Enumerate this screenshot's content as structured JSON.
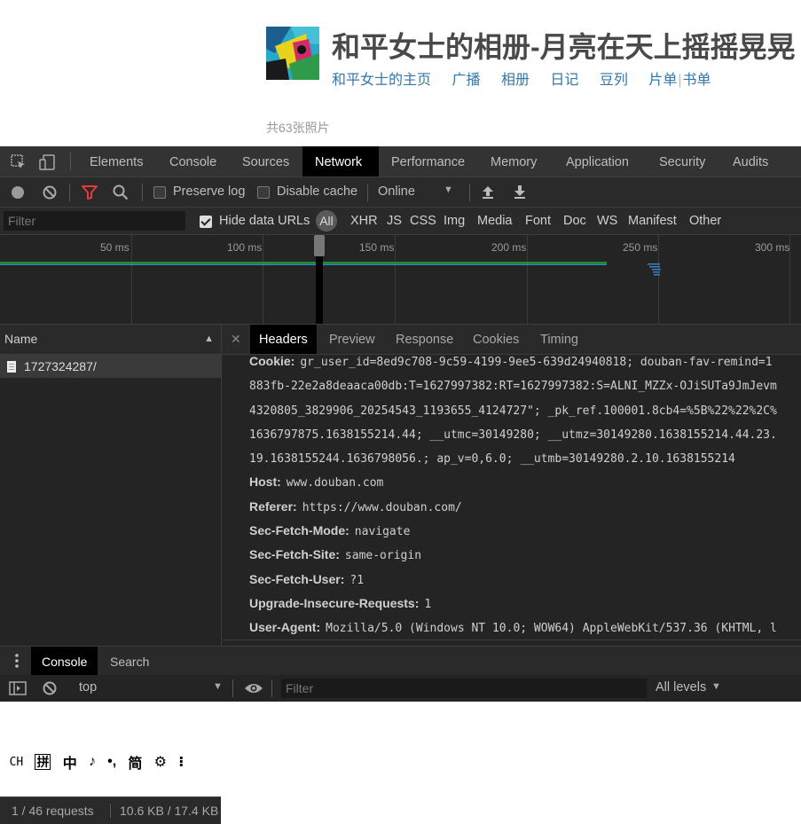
{
  "page": {
    "title": "和平女士的相册-月亮在天上摇摇晃晃",
    "nav": [
      "和平女士的主页",
      "广播",
      "相册",
      "日记",
      "豆列"
    ],
    "nav_extra": [
      "片单",
      "书单"
    ],
    "photo_count": "共63张照片"
  },
  "devtools": {
    "main_tabs": [
      "Elements",
      "Console",
      "Sources",
      "Network",
      "Performance",
      "Memory",
      "Application",
      "Security",
      "Audits"
    ],
    "active_tab": "Network",
    "toolbar": {
      "preserve_log": "Preserve log",
      "disable_cache": "Disable cache",
      "throttle": "Online"
    },
    "filterbar": {
      "filter_placeholder": "Filter",
      "hide_data_urls": "Hide data URLs",
      "types": [
        "All",
        "XHR",
        "JS",
        "CSS",
        "Img",
        "Media",
        "Font",
        "Doc",
        "WS",
        "Manifest",
        "Other"
      ]
    },
    "timeline_ticks": [
      "50 ms",
      "100 ms",
      "150 ms",
      "200 ms",
      "250 ms",
      "300 ms"
    ],
    "name_pane": {
      "header": "Name",
      "row": "1727324287/",
      "summary_requests": "1 / 46 requests",
      "summary_size": "10.6 KB / 17.4 KB"
    },
    "ime": [
      "CH",
      "拼",
      "中",
      "♪",
      "•,",
      "简",
      "⚙",
      "⁝"
    ],
    "detail_tabs": [
      "Headers",
      "Preview",
      "Response",
      "Cookies",
      "Timing"
    ],
    "active_detail_tab": "Headers",
    "headers": [
      {
        "key": "Cookie:",
        "value": "gr_user_id=8ed9c708-9c59-4199-9ee5-639d24940818; douban-fav-remind=1"
      },
      {
        "key": "",
        "value": "883fb-22e2a8deaaca00db:T=1627997382:RT=1627997382:S=ALNI_MZZx-OJiSUTa9JmJevm"
      },
      {
        "key": "",
        "value": "4320805_3829906_20254543_1193655_4124727\"; _pk_ref.100001.8cb4=%5B%22%22%2C%"
      },
      {
        "key": "",
        "value": "1636797875.1638155214.44; __utmc=30149280; __utmz=30149280.1638155214.44.23."
      },
      {
        "key": "",
        "value": "19.1638155244.1636798056.; ap_v=0,6.0; __utmb=30149280.2.10.1638155214"
      },
      {
        "key": "Host:",
        "value": "www.douban.com"
      },
      {
        "key": "Referer:",
        "value": "https://www.douban.com/"
      },
      {
        "key": "Sec-Fetch-Mode:",
        "value": "navigate"
      },
      {
        "key": "Sec-Fetch-Site:",
        "value": "same-origin"
      },
      {
        "key": "Sec-Fetch-User:",
        "value": "?1"
      },
      {
        "key": "Upgrade-Insecure-Requests:",
        "value": "1"
      },
      {
        "key": "User-Agent:",
        "value": "Mozilla/5.0 (Windows NT 10.0; WOW64) AppleWebKit/537.36 (KHTML, l"
      }
    ],
    "drawer_tabs": [
      "Console",
      "Search"
    ],
    "console": {
      "context": "top",
      "filter_placeholder": "Filter",
      "levels": "All levels"
    },
    "colors": {
      "accent_red": "#e5393d",
      "link_blue": "#3377aa",
      "timeline_green": "#1e8a3c",
      "timeline_blue": "#3b7fc4"
    }
  }
}
